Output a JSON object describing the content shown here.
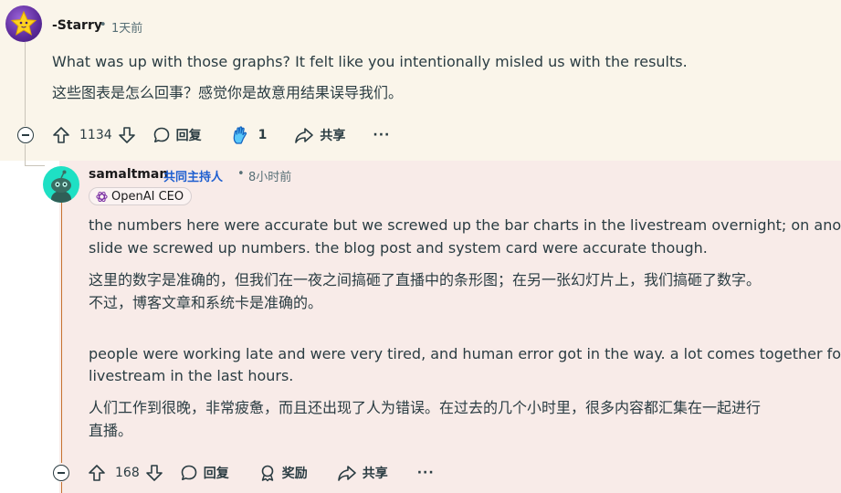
{
  "comment1": {
    "username": "-Starry",
    "time": "1天前",
    "text_en": "What was up with those graphs? It felt like you intentionally misled us with the results.",
    "text_zh": "这些图表是怎么回事？感觉你是故意用结果误导我们。",
    "upvotes": "1134",
    "reply_label": "回复",
    "award_count": "1",
    "share_label": "共享",
    "more_label": "···"
  },
  "comment2": {
    "username": "samaltman",
    "op_tag": "共同主持人",
    "time": "8小时前",
    "flair": "OpenAI CEO",
    "p1_line1": "the numbers here were accurate but we screwed up the bar charts in the livestream overnight; on another",
    "p1_line2": "slide we screwed up numbers. the blog post and system card were accurate though.",
    "p1_zh_line1": "这里的数字是准确的，但我们在一夜之间搞砸了直播中的条形图；在另一张幻灯片上，我们搞砸了数字。",
    "p1_zh_line2": "不过，博客文章和系统卡是准确的。",
    "p2_line1": "people were working late and were very tired, and human error got in the way. a lot comes together for a",
    "p2_line2": "livestream in the last hours.",
    "p2_zh_line1": "人们工作到很晚，非常疲惫，而且还出现了人为错误。在过去的几个小时里，很多内容都汇集在一起进行",
    "p2_zh_line2": "直播。",
    "upvotes": "168",
    "reply_label": "回复",
    "award_label": "奖励",
    "share_label": "共享",
    "more_label": "···"
  }
}
